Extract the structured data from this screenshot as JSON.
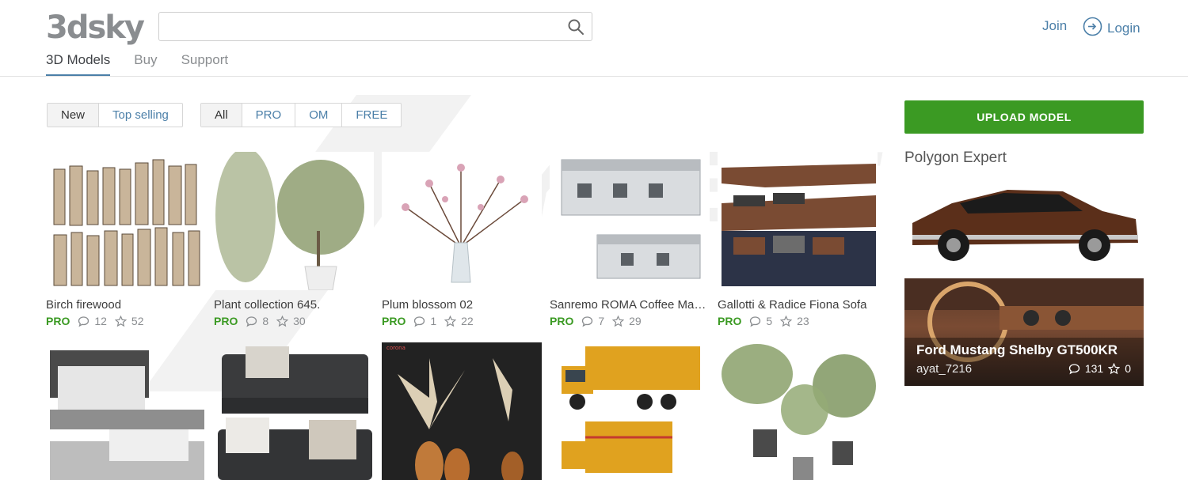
{
  "header": {
    "logo": "3dsky",
    "search": {
      "placeholder": "",
      "value": ""
    },
    "nav": [
      {
        "label": "3D Models",
        "active": true
      },
      {
        "label": "Buy",
        "active": false
      },
      {
        "label": "Support",
        "active": false
      }
    ],
    "join_label": "Join",
    "login_label": "Login"
  },
  "filters": {
    "sort": [
      {
        "label": "New",
        "active": true
      },
      {
        "label": "Top selling",
        "active": false
      }
    ],
    "type": [
      {
        "label": "All",
        "active": true
      },
      {
        "label": "PRO",
        "active": false
      },
      {
        "label": "OM",
        "active": false
      },
      {
        "label": "FREE",
        "active": false
      }
    ]
  },
  "sidebar": {
    "upload_label": "UPLOAD MODEL",
    "title": "Polygon Expert",
    "featured": {
      "title": "Ford Mustang Shelby GT500KR",
      "user": "ayat_7216",
      "comments": "131",
      "likes": "0"
    }
  },
  "models": [
    {
      "title": "Birch firewood",
      "badge": "PRO",
      "comments": "12",
      "likes": "52"
    },
    {
      "title": "Plant collection 645.",
      "badge": "PRO",
      "comments": "8",
      "likes": "30"
    },
    {
      "title": "Plum blossom 02",
      "badge": "PRO",
      "comments": "1",
      "likes": "22"
    },
    {
      "title": "Sanremo ROMA Coffee Machine",
      "badge": "PRO",
      "comments": "7",
      "likes": "29"
    },
    {
      "title": "Gallotti & Radice Fiona Sofa",
      "badge": "PRO",
      "comments": "5",
      "likes": "23"
    }
  ],
  "colors": {
    "accent": "#4b7fa8",
    "pro": "#3b9a23",
    "upload": "#3b9a23"
  },
  "icons": {
    "search": "search-icon",
    "login": "login-icon",
    "comment": "comment-icon",
    "star": "star-icon"
  }
}
